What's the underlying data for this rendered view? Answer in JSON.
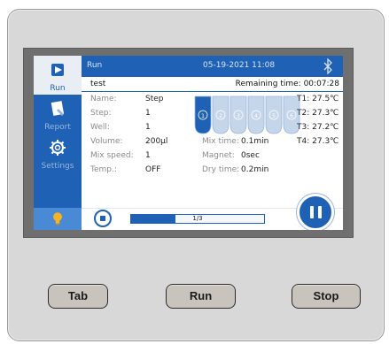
{
  "header": {
    "title": "Run",
    "datetime": "05-19-2021 11:08",
    "bluetooth_icon": "bluetooth-icon"
  },
  "sidebar": {
    "items": [
      {
        "label": "Run",
        "icon": "run-icon",
        "active": true
      },
      {
        "label": "Report",
        "icon": "report-icon",
        "active": false
      },
      {
        "label": "Settings",
        "icon": "settings-gear-icon",
        "active": false
      }
    ],
    "bulb_icon": "lightbulb-icon"
  },
  "program": {
    "name": "test",
    "remaining_label": "Remaining time:",
    "remaining_value": "00:07:28"
  },
  "params": {
    "name_label": "Name:",
    "name_value": "Step",
    "step_label": "Step:",
    "step_value": "1",
    "well_label": "Well:",
    "well_value": "1",
    "volume_label": "Volume:",
    "volume_value": "200μl",
    "mixspeed_label": "Mix speed:",
    "mixspeed_value": "1",
    "temp_label": "Temp.:",
    "temp_value": "OFF",
    "mixtime_label": "Mix time:",
    "mixtime_value": "0.1min",
    "magnet_label": "Magnet:",
    "magnet_value": "0sec",
    "drytime_label": "Dry time:",
    "drytime_value": "0.2min"
  },
  "wells": [
    "1",
    "2",
    "3",
    "4",
    "5",
    "6"
  ],
  "active_well": 1,
  "temperatures": [
    {
      "label": "T1:",
      "value": "27.5℃"
    },
    {
      "label": "T2:",
      "value": "27.3℃"
    },
    {
      "label": "T3:",
      "value": "27.2℃"
    },
    {
      "label": "T4:",
      "value": "27.3℃"
    }
  ],
  "progress": {
    "text": "1/3",
    "fraction": 0.333
  },
  "hardware_buttons": {
    "tab": "Tab",
    "run": "Run",
    "stop": "Stop"
  },
  "colors": {
    "accent": "#1f62b5",
    "screen_bg": "#ffffff",
    "device": "#d8d8d8"
  }
}
